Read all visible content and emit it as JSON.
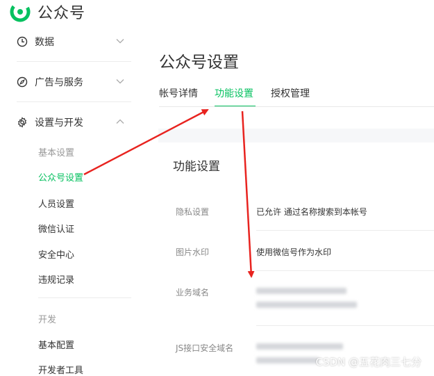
{
  "brand": {
    "name": "公众号"
  },
  "sidebar": {
    "groups": [
      {
        "label": "数据",
        "icon": "clock-icon",
        "expanded": false
      },
      {
        "label": "广告与服务",
        "icon": "compass-icon",
        "expanded": false
      },
      {
        "label": "设置与开发",
        "icon": "gear-icon",
        "expanded": true
      }
    ],
    "items": [
      {
        "label": "基本设置",
        "state": "muted"
      },
      {
        "label": "公众号设置",
        "state": "active"
      },
      {
        "label": "人员设置",
        "state": "normal"
      },
      {
        "label": "微信认证",
        "state": "normal"
      },
      {
        "label": "安全中心",
        "state": "normal"
      },
      {
        "label": "违规记录",
        "state": "normal"
      },
      {
        "label": "开发",
        "state": "muted"
      },
      {
        "label": "基本配置",
        "state": "normal"
      },
      {
        "label": "开发者工具",
        "state": "normal"
      }
    ]
  },
  "main": {
    "title": "公众号设置",
    "tabs": [
      {
        "label": "帐号详情",
        "active": false
      },
      {
        "label": "功能设置",
        "active": true
      },
      {
        "label": "授权管理",
        "active": false
      }
    ],
    "card_title": "功能设置",
    "rows": [
      {
        "label": "隐私设置",
        "value": "已允许 通过名称搜索到本帐号"
      },
      {
        "label": "图片水印",
        "value": "使用微信号作为水印"
      },
      {
        "label": "业务域名",
        "value": ""
      },
      {
        "label": "JS接口安全域名",
        "value": ""
      }
    ]
  },
  "colors": {
    "accent": "#07c160",
    "annotation_arrow": "#e8231f"
  },
  "watermark": "CSDN @五花肉三七分"
}
